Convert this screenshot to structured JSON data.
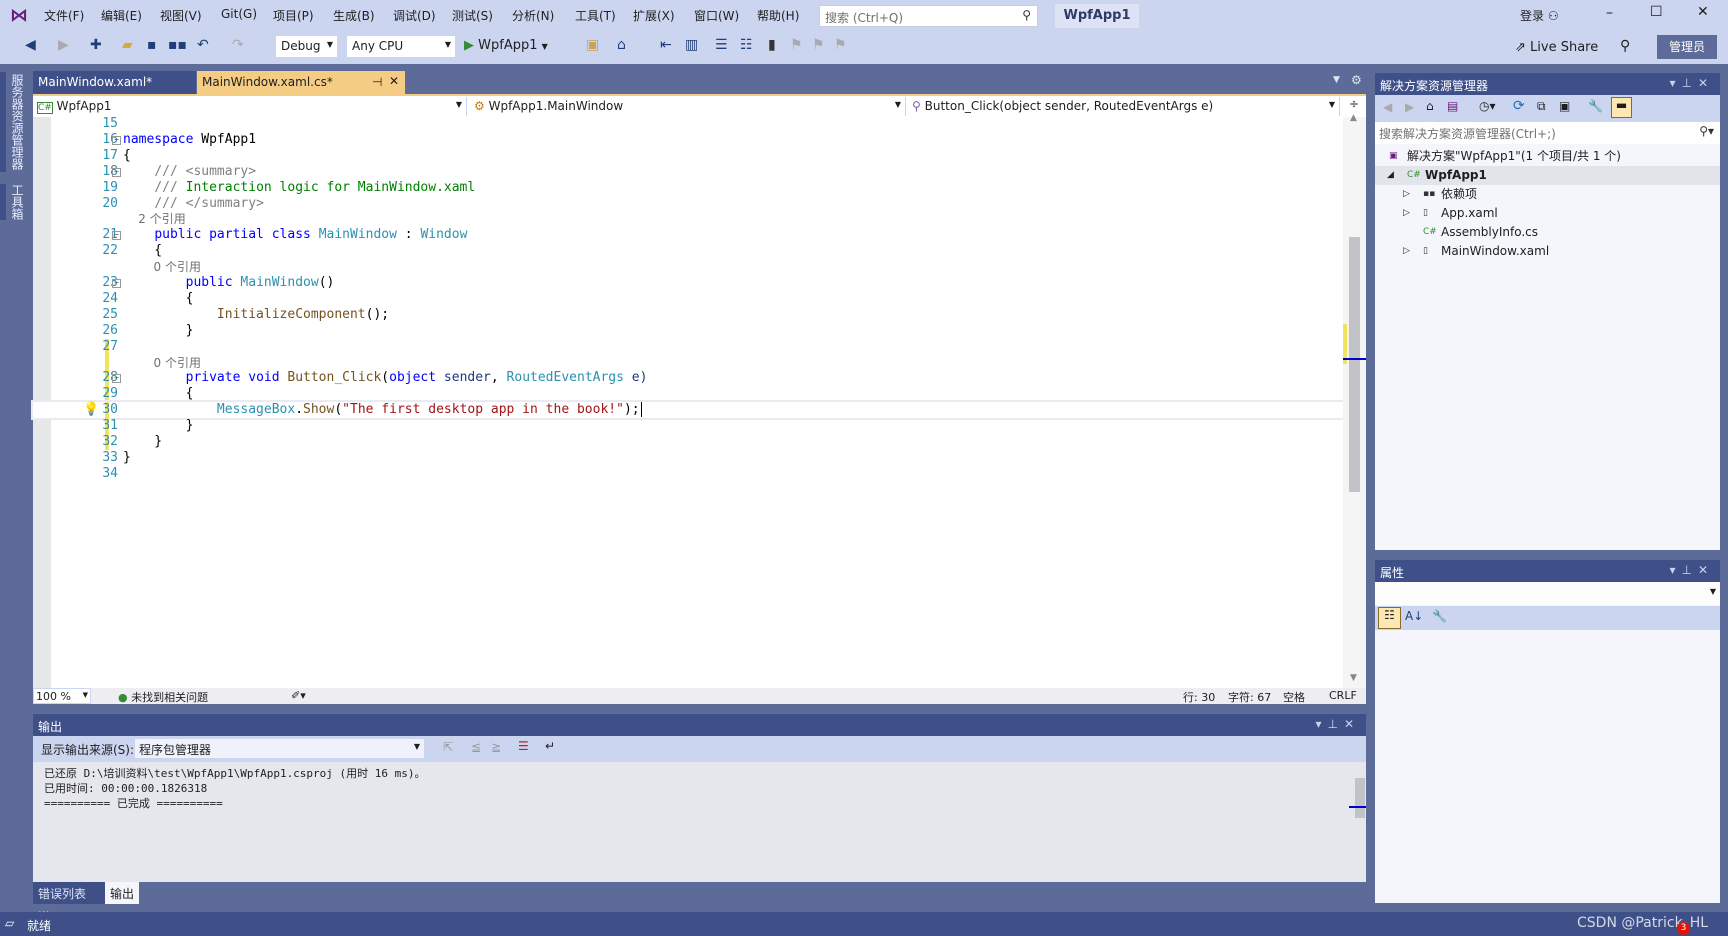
{
  "titlebar": {
    "menus": [
      "文件(F)",
      "编辑(E)",
      "视图(V)",
      "Git(G)",
      "项目(P)",
      "生成(B)",
      "调试(D)",
      "测试(S)",
      "分析(N)",
      "工具(T)",
      "扩展(X)",
      "窗口(W)",
      "帮助(H)"
    ],
    "search_placeholder": "搜索 (Ctrl+Q)",
    "project_name": "WpfApp1",
    "login": "登录",
    "window_controls": [
      "minimize",
      "maximize",
      "close"
    ]
  },
  "toolbar": {
    "config": "Debug",
    "platform": "Any CPU",
    "start_label": "WpfApp1",
    "live_share": "Live Share",
    "admin": "管理员"
  },
  "left_tabs": [
    "服务器资源管理器",
    "工具箱"
  ],
  "doc_tabs": [
    {
      "label": "MainWindow.xaml*",
      "active": false
    },
    {
      "label": "MainWindow.xaml.cs*",
      "active": true
    }
  ],
  "navbar": {
    "project": "WpfApp1",
    "type": "WpfApp1.MainWindow",
    "member": "Button_Click(object sender, RoutedEventArgs e)"
  },
  "code": [
    {
      "n": "15",
      "t": []
    },
    {
      "n": "16",
      "fold": true,
      "t": [
        [
          "namespace",
          "kw"
        ],
        [
          " WpfApp1",
          "pl"
        ]
      ]
    },
    {
      "n": "17",
      "t": [
        [
          "{",
          "pl"
        ]
      ]
    },
    {
      "n": "18",
      "fold": true,
      "t": [
        [
          "    ",
          "pl"
        ],
        [
          "/// ",
          "cg"
        ],
        [
          "<summary>",
          "cg"
        ]
      ]
    },
    {
      "n": "19",
      "t": [
        [
          "    ",
          "pl"
        ],
        [
          "/// ",
          "cg"
        ],
        [
          "Interaction logic for MainWindow.xaml",
          "cm"
        ]
      ]
    },
    {
      "n": "20",
      "t": [
        [
          "    ",
          "pl"
        ],
        [
          "/// ",
          "cg"
        ],
        [
          "</summary>",
          "cg"
        ]
      ]
    },
    {
      "n": "",
      "lens": "    2 个引用"
    },
    {
      "n": "21",
      "fold": true,
      "t": [
        [
          "    ",
          "pl"
        ],
        [
          "public partial class ",
          "kw"
        ],
        [
          "MainWindow",
          "cl"
        ],
        [
          " : ",
          "pl"
        ],
        [
          "Window",
          "cl"
        ]
      ]
    },
    {
      "n": "22",
      "t": [
        [
          "    {",
          "pl"
        ]
      ]
    },
    {
      "n": "",
      "lens": "        0 个引用"
    },
    {
      "n": "23",
      "fold": true,
      "t": [
        [
          "        ",
          "pl"
        ],
        [
          "public ",
          "kw"
        ],
        [
          "MainWindow",
          "cl"
        ],
        [
          "()",
          "pl"
        ]
      ]
    },
    {
      "n": "24",
      "t": [
        [
          "        {",
          "pl"
        ]
      ]
    },
    {
      "n": "25",
      "t": [
        [
          "            ",
          "pl"
        ],
        [
          "InitializeComponent",
          "mt"
        ],
        [
          "();",
          "pl"
        ]
      ]
    },
    {
      "n": "26",
      "t": [
        [
          "        }",
          "pl"
        ]
      ]
    },
    {
      "n": "27",
      "chg": true,
      "t": []
    },
    {
      "n": "",
      "chg": true,
      "lens": "        0 个引用"
    },
    {
      "n": "28",
      "fold": true,
      "chg": true,
      "t": [
        [
          "        ",
          "pl"
        ],
        [
          "private void ",
          "kw"
        ],
        [
          "Button_Click",
          "mt"
        ],
        [
          "(",
          "pl"
        ],
        [
          "object ",
          "kw"
        ],
        [
          "sender",
          "id"
        ],
        [
          ", ",
          "pl"
        ],
        [
          "RoutedEventArgs",
          "cl"
        ],
        [
          " e)",
          "id"
        ]
      ]
    },
    {
      "n": "29",
      "chg": true,
      "t": [
        [
          "        {",
          "pl"
        ]
      ]
    },
    {
      "n": "30",
      "chg": true,
      "current": true,
      "bulb": true,
      "t": [
        [
          "            ",
          "pl"
        ],
        [
          "MessageBox",
          "cl"
        ],
        [
          ".",
          "pl"
        ],
        [
          "Show",
          "mt"
        ],
        [
          "(",
          "pl"
        ],
        [
          "\"The first desktop app in the book!\"",
          "st"
        ],
        [
          ");",
          "pl"
        ]
      ]
    },
    {
      "n": "31",
      "chg": true,
      "t": [
        [
          "        }",
          "pl"
        ]
      ]
    },
    {
      "n": "32",
      "chg": true,
      "t": [
        [
          "    }",
          "pl"
        ]
      ]
    },
    {
      "n": "33",
      "t": [
        [
          "}",
          "pl"
        ]
      ]
    },
    {
      "n": "34",
      "t": []
    }
  ],
  "editor_status": {
    "zoom": "100 %",
    "issues": "未找到相关问题",
    "line": "行: 30",
    "char": "字符: 67",
    "spaces": "空格",
    "eol": "CRLF"
  },
  "output": {
    "title": "输出",
    "source_label": "显示输出来源(S):",
    "source_value": "程序包管理器",
    "lines": [
      "已还原 D:\\培训资料\\test\\WpfApp1\\WpfApp1.csproj (用时 16 ms)。",
      "已用时间: 00:00:00.1826318",
      "========== 已完成 =========="
    ]
  },
  "bottom_tabs": [
    {
      "label": "错误列表 ...",
      "active": false
    },
    {
      "label": "输出",
      "active": true
    }
  ],
  "status": {
    "text": "就绪",
    "watermark": "CSDN @Patrick_HL",
    "notifications": "3"
  },
  "solution_explorer": {
    "title": "解决方案资源管理器",
    "search_placeholder": "搜索解决方案资源管理器(Ctrl+;)",
    "items": [
      {
        "label": "解决方案\"WpfApp1\"(1 个项目/共 1 个)",
        "level": 0,
        "icon": "solution-icon",
        "expander": ""
      },
      {
        "label": "WpfApp1",
        "level": 1,
        "icon": "csharp-project-icon",
        "expander": "◢",
        "bold": true,
        "selected": true
      },
      {
        "label": "依赖项",
        "level": 2,
        "icon": "dependencies-icon",
        "expander": "▷"
      },
      {
        "label": "App.xaml",
        "level": 2,
        "icon": "xaml-file-icon",
        "expander": "▷"
      },
      {
        "label": "AssemblyInfo.cs",
        "level": 2,
        "icon": "csharp-file-icon",
        "expander": ""
      },
      {
        "label": "MainWindow.xaml",
        "level": 2,
        "icon": "xaml-file-icon",
        "expander": "▷"
      }
    ]
  },
  "properties": {
    "title": "属性"
  },
  "colors": {
    "chrome": "#ccd5f0",
    "frame": "#5d6b99",
    "panel_header": "#3f5089",
    "active_tab": "#f5cc84"
  }
}
